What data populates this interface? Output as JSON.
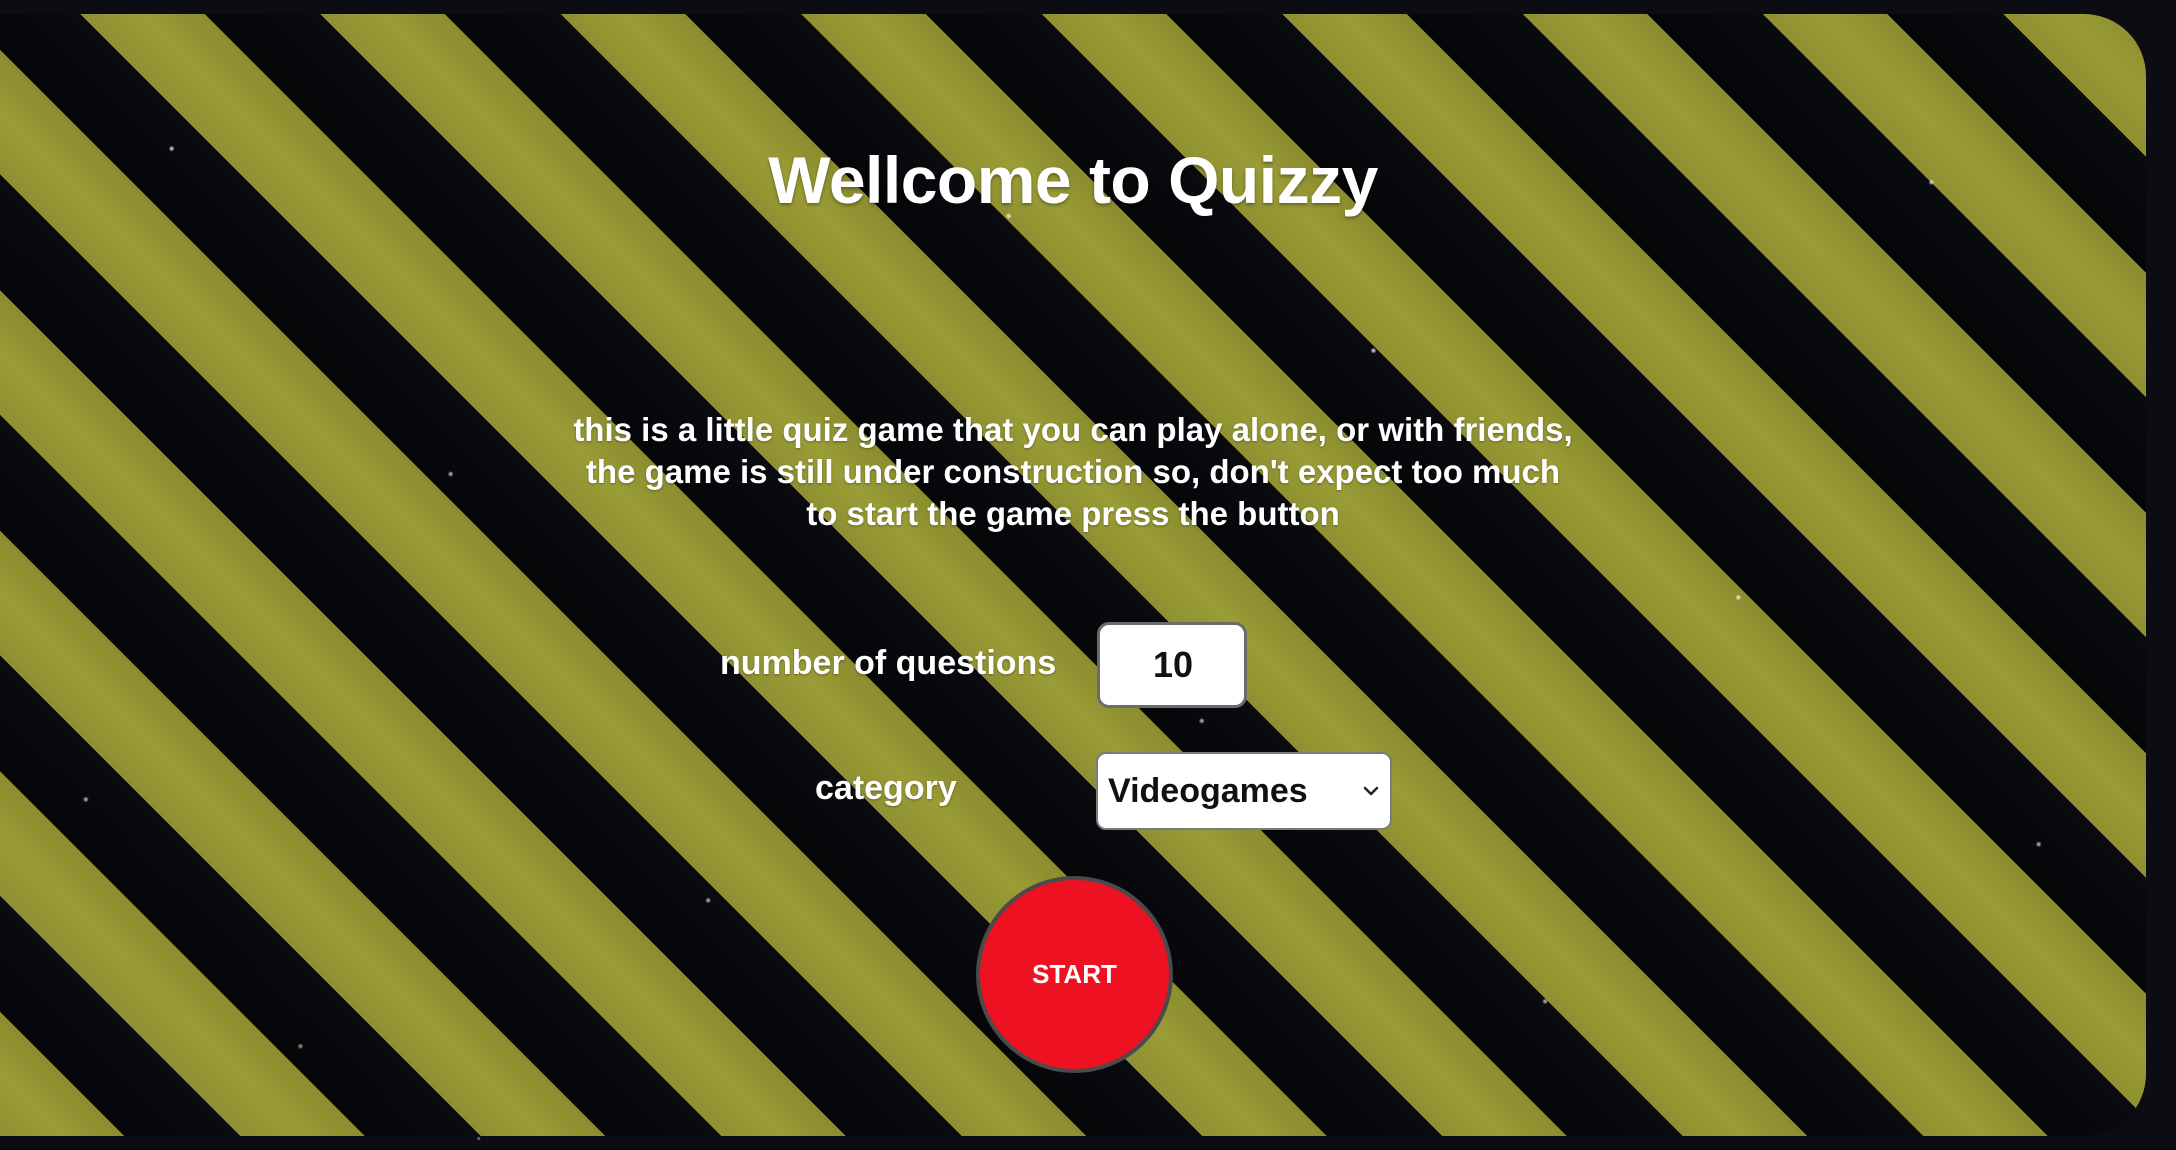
{
  "header": {
    "title": "Wellcome to Quizzy"
  },
  "intro": {
    "lines": [
      "this is a little quiz game that you can play alone, or with friends,",
      "the game is still under construction so, don't expect too much",
      "to start the game press the button"
    ]
  },
  "form": {
    "questions_label": "number of questions",
    "questions_value": "10",
    "category_label": "category",
    "category_value": "Videogames"
  },
  "actions": {
    "start_label": "START"
  },
  "colors": {
    "stripe": "#9a9c36",
    "background": "#050608",
    "start_button": "#ee1122",
    "text": "#ffffff"
  },
  "icons": {
    "select_arrow": "chevron-down-icon"
  }
}
